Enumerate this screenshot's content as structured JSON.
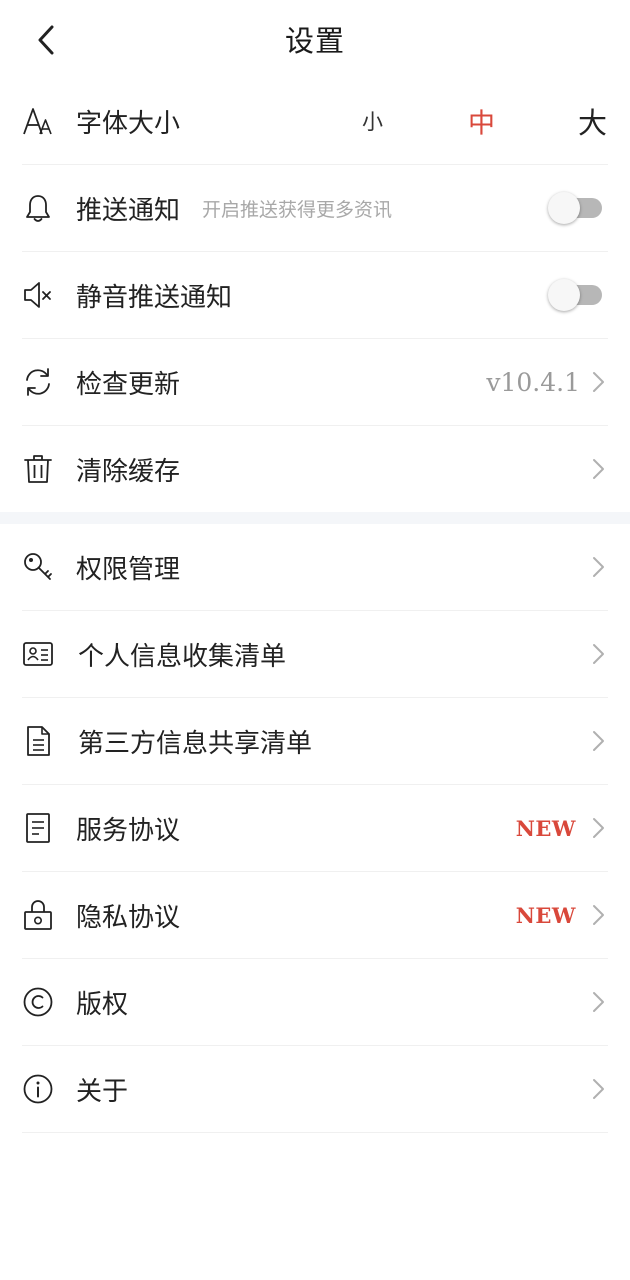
{
  "header": {
    "title": "设置"
  },
  "font_size": {
    "label": "字体大小",
    "options": [
      "小",
      "中",
      "大"
    ],
    "selected": "中"
  },
  "push": {
    "label": "推送通知",
    "hint": "开启推送获得更多资讯",
    "enabled": false
  },
  "mute_push": {
    "label": "静音推送通知",
    "enabled": false
  },
  "update": {
    "label": "检查更新",
    "version": "v10.4.1"
  },
  "cache": {
    "label": "清除缓存"
  },
  "section2": [
    {
      "label": "权限管理",
      "icon": "key-icon"
    },
    {
      "label": "个人信息收集清单",
      "icon": "id-card-icon"
    },
    {
      "label": "第三方信息共享清单",
      "icon": "document-icon"
    },
    {
      "label": "服务协议",
      "icon": "agreement-icon",
      "badge": "NEW"
    },
    {
      "label": "隐私协议",
      "icon": "lock-icon",
      "badge": "NEW"
    },
    {
      "label": "版权",
      "icon": "copyright-icon"
    },
    {
      "label": "关于",
      "icon": "info-icon"
    }
  ],
  "colors": {
    "accent": "#d9483b",
    "text": "#222222",
    "muted": "#9a9a9a",
    "divider": "#f0f0f0",
    "section_bg": "#f4f6f9"
  }
}
